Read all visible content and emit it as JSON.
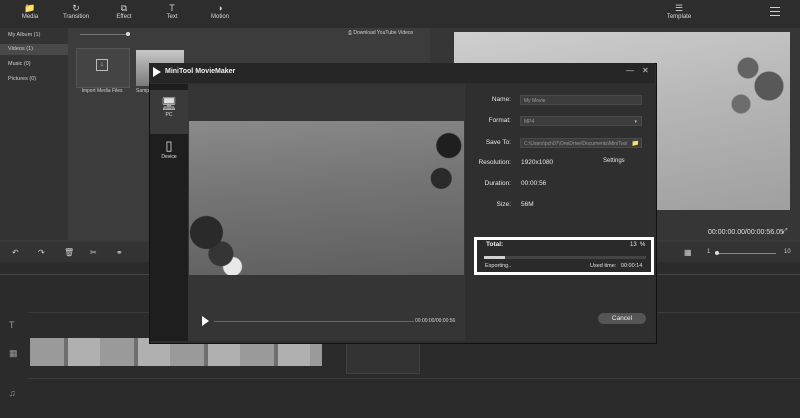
{
  "toolbar": {
    "media": "Media",
    "transition": "Transition",
    "effect": "Effect",
    "text": "Text",
    "motion": "Motion",
    "template": "Template"
  },
  "library": {
    "items": [
      {
        "label": "My Album  (1)"
      },
      {
        "label": "Videos  (1)"
      },
      {
        "label": "Music  (0)"
      },
      {
        "label": "Pictures  (0)"
      }
    ],
    "import_label": "Import Media Files",
    "sample_label": "Samp",
    "download_label": "Download YouTube Videos"
  },
  "preview": {
    "time": "00:00:00.00/00:00:56.05"
  },
  "timeline": {
    "zoom_min": "1",
    "zoom_max": "10"
  },
  "dialog": {
    "title": "MiniTool MovieMaker",
    "tabs": [
      {
        "label": "PC"
      },
      {
        "label": "Device"
      }
    ],
    "player_time": "00:00:00/00:00:56",
    "fields": {
      "name_label": "Name:",
      "name_value": "My Movie",
      "format_label": "Format:",
      "format_value": "MP4",
      "saveto_label": "Save To:",
      "saveto_value": "C:\\Users\\pch07\\OneDrive\\Documents\\MiniTool",
      "resolution_label": "Resolution:",
      "resolution_value": "1920x1080",
      "settings_label": "Settings",
      "duration_label": "Duration:",
      "duration_value": "00:00:56",
      "size_label": "Size:",
      "size_value": "56M"
    },
    "progress": {
      "total_label": "Total:",
      "percent": "13",
      "percent_sign": "%",
      "fraction": 0.13,
      "status": "Exporting..",
      "used_label": "Used time:",
      "used_value": "00:00:14"
    },
    "cancel_label": "Cancel"
  }
}
